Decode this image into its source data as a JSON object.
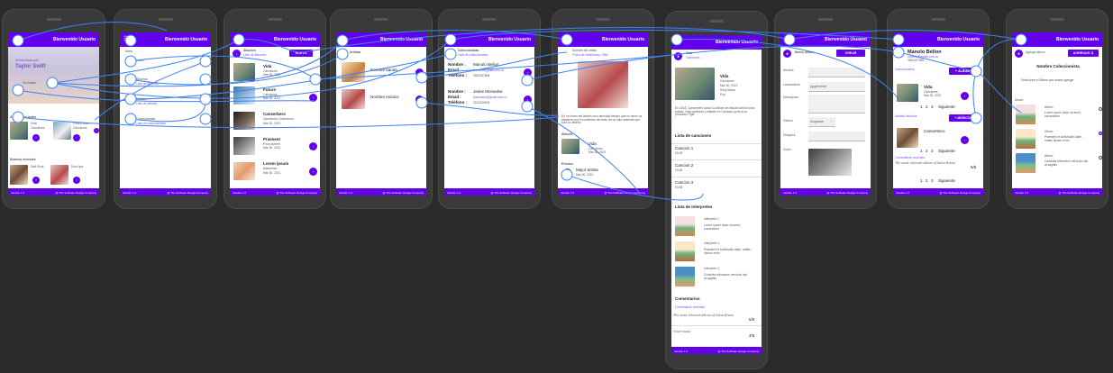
{
  "colors": {
    "primary": "#6200ee",
    "wire": "#3b82f6",
    "canvas": "#2b2b2b"
  },
  "common": {
    "topbar_title": "Bienvenido Usuario",
    "version": "Versión 1.0",
    "company": "@ The Software Design Company"
  },
  "s1": {
    "hero_small": "Artista destacado",
    "hero_name": "Taylor Swift",
    "hero_btn": "Ver Artista",
    "albums_label": "Álbumes recientes",
    "album1_title": "Vida",
    "album1_sub": "Canciones",
    "album2_title": "Future Nos...",
    "album2_sub": "Canciones",
    "music_label": "Músicos recientes",
    "m1": "Daft Punk",
    "m2": "Dua Lipa"
  },
  "s2": {
    "menu_label": "Menú",
    "items": [
      "Home",
      "Álbumes",
      "Artistas",
      "Coleccionistas"
    ],
    "subs": [
      "",
      "Lista de álbumes",
      "Lista de artistas",
      "Lista de coleccionistas"
    ],
    "title": "Bienvenido Usuario"
  },
  "s3": {
    "header": "Álbumes",
    "header_sub": "Lista de Álbumes",
    "new_btn": "NUEVO",
    "rows": [
      {
        "t": "Vida",
        "s": "Canciones",
        "d": "Mar 30, 2021"
      },
      {
        "t": "Future",
        "s": "Canciones",
        "d": "Mar 30, 2021"
      },
      {
        "t": "Canserbero",
        "s": "Canciones Canserbero",
        "d": "Mar 30, 2021"
      },
      {
        "t": "Praesent",
        "s": "Proin laoreet",
        "d": "Mar 30, 2021"
      },
      {
        "t": "Lorem ipsum",
        "s": "Maecenas",
        "d": "Mar 30, 2021"
      }
    ]
  },
  "s4": {
    "header": "Artistas",
    "rows": [
      "Nombre banda",
      "Nombre músico"
    ]
  },
  "s5": {
    "header": "Coleccionistas",
    "header_sub": "Lista de coleccionistas",
    "c1": {
      "k1": "Nombre :",
      "v1": "Manolo Bellon",
      "k2": "Email :",
      "v2": "manollo@gmail.com.co",
      "k3": "Teléfono :",
      "v3": "3502457896"
    },
    "c2": {
      "k1": "Nombre :",
      "v1": "Jaime Monsalve",
      "k2": "Email :",
      "v2": "jmonsalve@gmail.com.co",
      "k3": "Teléfono :",
      "v3": "3012205678"
    }
  },
  "s6": {
    "header": "Nombre del artista",
    "header_sub": "Fecha de Nacimiento 1984",
    "bio": "En un lorem est laboris loco desnudo tiempo que un lector se distraerá con el contenido del texto de un sitio mientras que mira su diseño.",
    "albums_label": "Álbums",
    "album": "Vida",
    "album_sub": "Canciones",
    "album_date": "Mar 30, 2021",
    "prizes_label": "Premios",
    "prize": "Mejor artista",
    "prize_date": "Mar 30, 2021"
  },
  "s7": {
    "title": "Vida",
    "sub": "Canciones",
    "date": "Mar 30, 2021",
    "label": "Sony Music",
    "genre": "Pop",
    "desc": "En 2018, Canserbero lanzó su álbum de estudio debut como solista, Vida, grabado y editado en Caracas, junto a su productor Figo.",
    "songs_label": "Lista de canciones",
    "songs": [
      {
        "t": "Canción 1",
        "d": "03:35"
      },
      {
        "t": "Canción 2",
        "d": "03:35"
      },
      {
        "t": "Canción 3",
        "d": "03:35"
      }
    ],
    "perf_label": "Lista de interpretes",
    "perf": [
      {
        "t": "Interprete 1",
        "d": "Lorem ipsum dolor sit amet, consectetur"
      },
      {
        "t": "Interprete 2",
        "d": "Praesent et sollicitudin diam, mattis dictum enim"
      },
      {
        "t": "Interprete 3",
        "d": "Curabitur bibendum vehicula nisi at sagittis"
      }
    ],
    "comments_label": "Comentarios",
    "comments_sub": "Comentarios recientes",
    "comments": [
      {
        "t": "The most relevant album of Salsa Brava",
        "r": "5/5"
      },
      {
        "t": "Good music",
        "r": "4/5"
      }
    ]
  },
  "s8": {
    "header": "Nuevo Álbum",
    "create_btn": "CREAR",
    "labels": [
      "Nombre",
      "Lanzamiento",
      "Descripción",
      "Género",
      "Disquera",
      "Cover"
    ],
    "date_placeholder": "yyyy/mm/dd",
    "genre_value": "Dropdown"
  },
  "s9": {
    "name": "Manolo Bellon",
    "email": "manollo@gmail.com.co",
    "phone": "3502457896",
    "albums_label": "Coleccionados",
    "add_album": "ÁLBUM",
    "album": "Vida",
    "album_sub": "Canciones",
    "album_date": "Mar 30, 2021",
    "pager": [
      "1",
      "2",
      "3",
      "Siguiente"
    ],
    "artists_label": "Artistas favoritos",
    "add_artist": "MÚSICO",
    "artist": "Canserbero",
    "comments_label": "Comentarios recientes",
    "comment": "The most relevant album of Salsa Brava",
    "rating": "5/5"
  },
  "s10": {
    "header": "Agregar álbum",
    "btn": "AGREGAR",
    "title": "Nombre Coleccionista",
    "subtitle": "Seleccione el Álbum que desea agregar",
    "albums_label": "Album",
    "items": [
      {
        "t": "Album",
        "d": "Lorem ipsum dolor sit amet, consectetur"
      },
      {
        "t": "Album",
        "d": "Praesent et sollicitudin diam, mattis dictum enim"
      },
      {
        "t": "Album",
        "d": "Curabitur bibendum vehicula nisi at sagittis"
      }
    ]
  }
}
